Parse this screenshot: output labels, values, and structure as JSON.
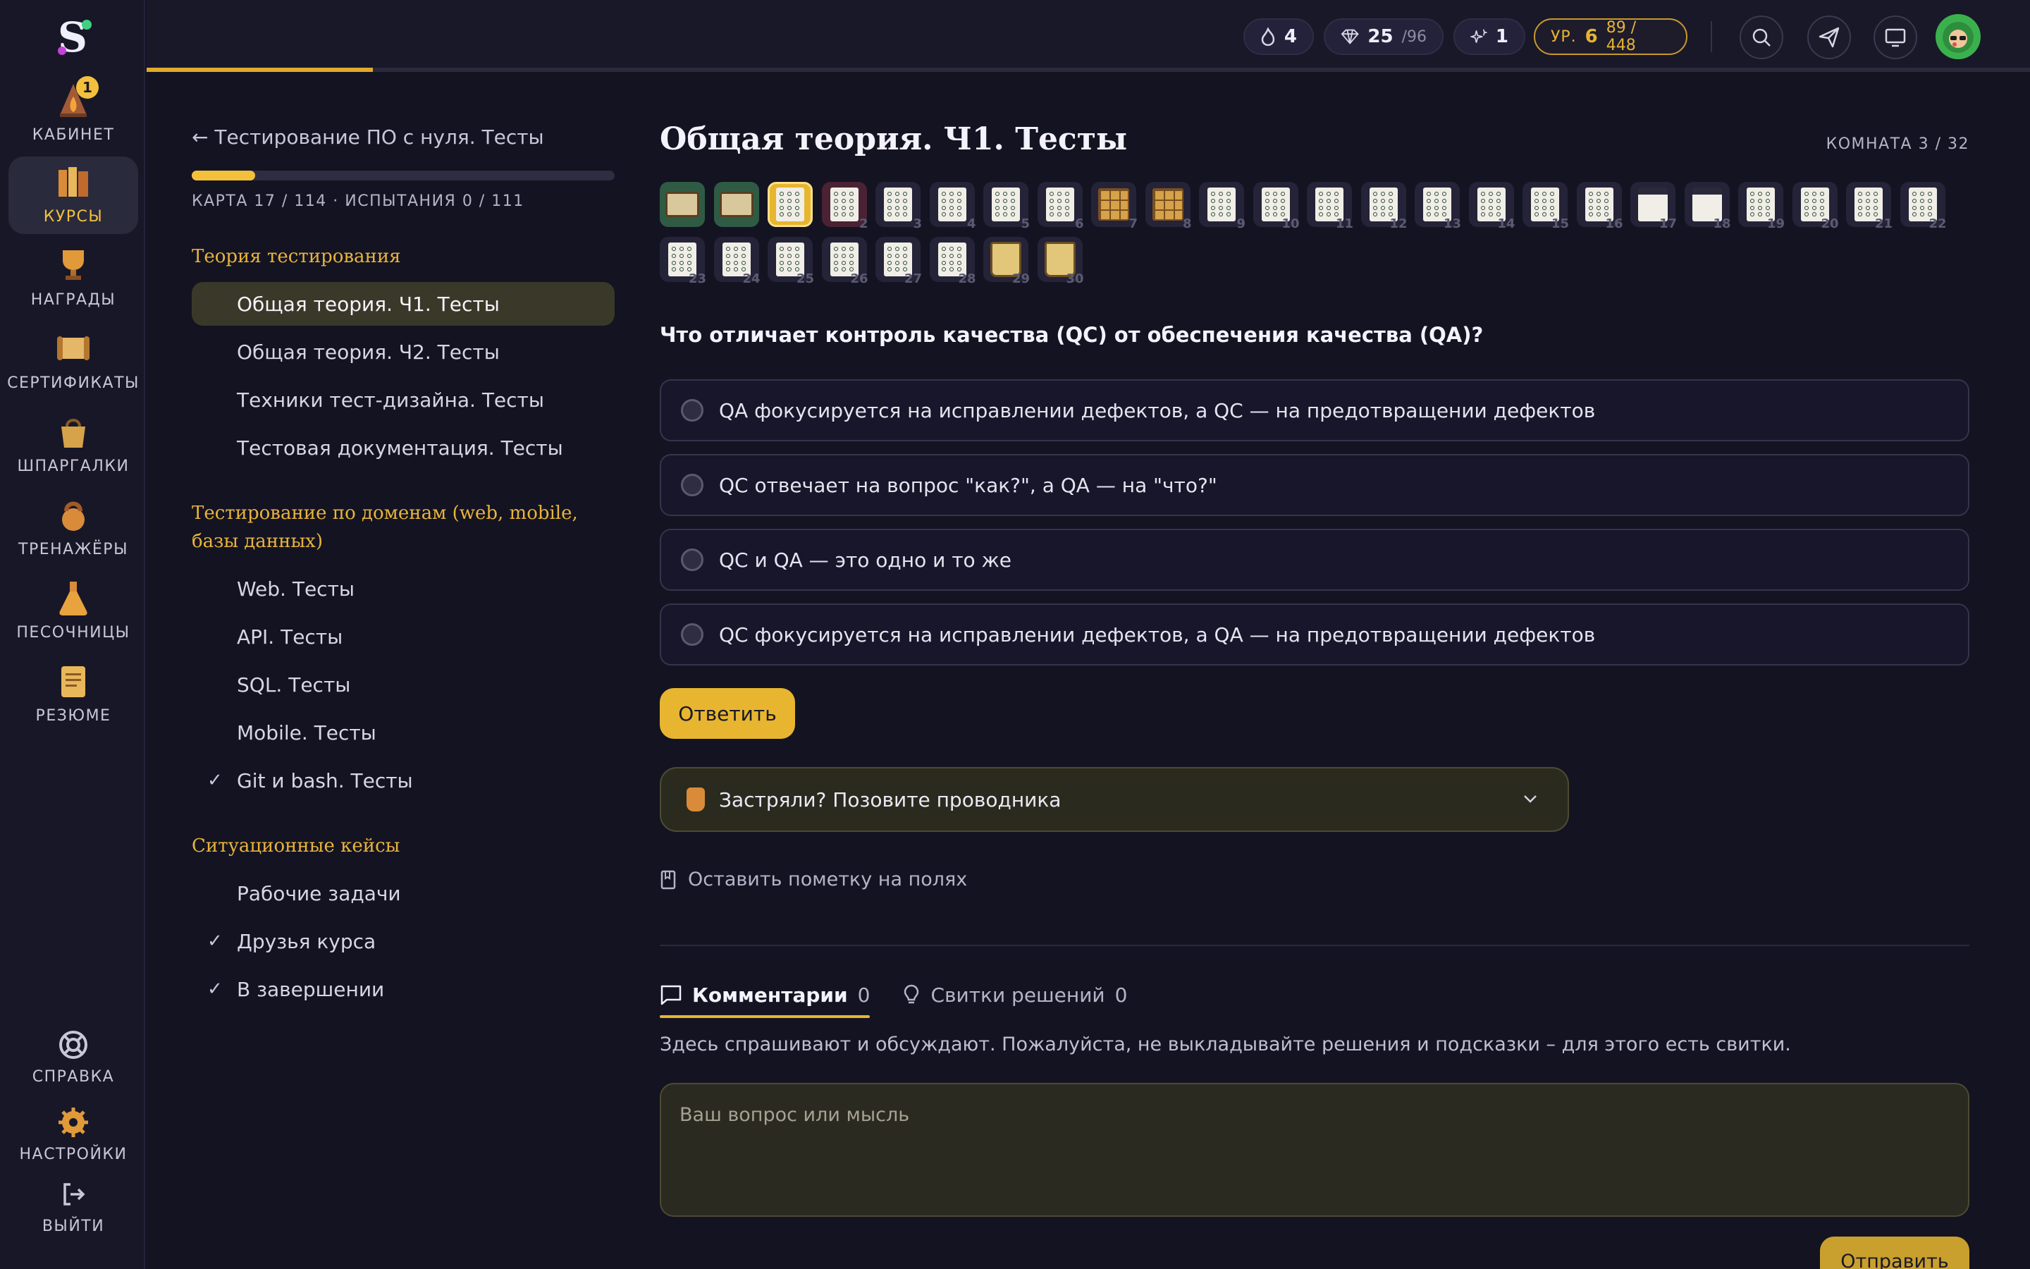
{
  "rail": {
    "items": [
      {
        "label": "КАБИНЕТ",
        "badge": "1",
        "icon": "campfire-icon"
      },
      {
        "label": "КУРСЫ",
        "icon": "books-icon"
      },
      {
        "label": "НАГРАДЫ",
        "icon": "trophy-icon"
      },
      {
        "label": "СЕРТИФИКАТЫ",
        "icon": "scroll-icon"
      },
      {
        "label": "ШПАРГАЛКИ",
        "icon": "bag-icon"
      },
      {
        "label": "ТРЕНАЖЁРЫ",
        "icon": "kettlebell-icon"
      },
      {
        "label": "ПЕСОЧНИЦЫ",
        "icon": "flask-icon"
      },
      {
        "label": "РЕЗЮМЕ",
        "icon": "document-icon"
      }
    ],
    "bottom": [
      {
        "label": "СПРАВКА",
        "icon": "lifebuoy-icon"
      },
      {
        "label": "НАСТРОЙКИ",
        "icon": "gear-icon"
      },
      {
        "label": "ВЫЙТИ",
        "icon": "logout-icon"
      }
    ]
  },
  "topbar": {
    "streak": "4",
    "gems": "25",
    "gems_total": "/96",
    "sparks": "1",
    "level_prefix": "УР.",
    "level": "6",
    "xp": "89 / 448",
    "progress_fraction": 0.12
  },
  "course": {
    "back": "← Тестирование ПО с нуля. Тесты",
    "progress_fraction": 0.15,
    "stats": "КАРТА 17 / 114 · ИСПЫТАНИЯ 0 / 111",
    "sections": [
      {
        "title": "Теория тестирования",
        "lessons": [
          {
            "label": "Общая теория. Ч1. Тесты",
            "active": true,
            "done": false
          },
          {
            "label": "Общая теория. Ч2. Тесты",
            "done": false
          },
          {
            "label": "Техники тест-дизайна. Тесты",
            "done": false
          },
          {
            "label": "Тестовая документация. Тесты",
            "done": false
          }
        ]
      },
      {
        "title": "Тестирование по доменам (web, mobile, базы данных)",
        "lessons": [
          {
            "label": "Web. Тесты",
            "done": false
          },
          {
            "label": "API. Тесты",
            "done": false
          },
          {
            "label": "SQL. Тесты",
            "done": false
          },
          {
            "label": "Mobile. Тесты",
            "done": false
          },
          {
            "label": "Git и bash. Тесты",
            "done": true
          }
        ]
      },
      {
        "title": "Ситуационные кейсы",
        "lessons": [
          {
            "label": "Рабочие задачи",
            "done": false
          },
          {
            "label": "Друзья курса",
            "done": true
          },
          {
            "label": "В завершении",
            "done": true
          }
        ]
      }
    ]
  },
  "main": {
    "title": "Общая теория. Ч1. Тесты",
    "room": "КОМНАТА 3 / 32",
    "question": "Что отличает контроль качества (QC) от обеспечения качества (QA)?",
    "options": [
      "QA фокусируется на исправлении дефектов, а QC — на предотвращении дефектов",
      "QC отвечает на вопрос \"как?\", а QA — на \"что?\"",
      "QC и QA — это одно и то же",
      "QC фокусируется на исправлении дефектов, а QA — на предотвращении дефектов"
    ],
    "answer_button": "Ответить",
    "guide": "Застряли? Позовите проводника",
    "note": "Оставить пометку на полях",
    "tabs": [
      {
        "label": "Комментарии",
        "count": "0"
      },
      {
        "label": "Свитки решений",
        "count": "0"
      }
    ],
    "hint": "Здесь спрашивают и обсуждают. Пожалуйста, не выкладывайте решения и подсказки – для этого есть свитки.",
    "comment_placeholder": "Ваш вопрос или мысль",
    "send_button": "Отправить"
  }
}
